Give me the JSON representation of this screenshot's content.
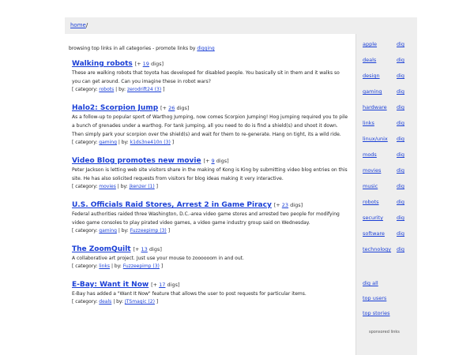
{
  "breadcrumb": {
    "home": "home",
    "separator": "/"
  },
  "intro": {
    "text": "browsing top links in all categories - promote links by",
    "link": "digging"
  },
  "stories": [
    {
      "title": "Walking robots",
      "diggs_open": "[+",
      "diggs_count": "19",
      "diggs_close": "digs]",
      "desc": "These are walking robots that toyota has developed for disabled people. You basically sit in them and it walks so you can get around. Can you imagine these in robot wars?",
      "meta_open": "[ category:",
      "category": "robots",
      "meta_by": "| by:",
      "user": "zerodrift24 (3)",
      "meta_close": "]"
    },
    {
      "title": "Halo2: Scorpion Jump",
      "diggs_open": "[+",
      "diggs_count": "26",
      "diggs_close": "digs]",
      "desc": "As a follow-up to popular sport of Warthog Jumping, now comes Scorpion Jumping! Hog jumping required you to pile a bunch of grenades under a warthog. For tank jumping, all you need to do is find a shield(s) and shoot it down. Then simply park your scorpion over the shield(s) and wait for them to re-generate. Hang on tight, its a wild ride.",
      "meta_open": "[ category:",
      "category": "gaming",
      "meta_by": "| by:",
      "user": "k1ds3ne410n (3)",
      "meta_close": "]"
    },
    {
      "title": "Video Blog promotes new movie",
      "diggs_open": "[+",
      "diggs_count": "9",
      "diggs_close": "digs]",
      "desc": "Peter Jackson is letting web site visitors share in the making of Kong is King by submitting video blog entries on this site. He has also solicited requests from visitors for blog ideas making it very interactive.",
      "meta_open": "[ category:",
      "category": "movies",
      "meta_by": "| by:",
      "user": "jkenzer (1)",
      "meta_close": "]"
    },
    {
      "title": "U.S. Officials Raid Stores, Arrest 2 in Game Piracy",
      "diggs_open": "[+",
      "diggs_count": "23",
      "diggs_close": "digs]",
      "desc": "Federal authorities raided three Washington, D.C.-area video game stores and arrested two people for modifying video game consoles to play pirated video games, a video game industry group said on Wednesday.",
      "meta_open": "[ category:",
      "category": "gaming",
      "meta_by": "| by:",
      "user": "Fuzzeepimp (3)",
      "meta_close": "]"
    },
    {
      "title": "The ZoomQuilt",
      "diggs_open": "[+",
      "diggs_count": "13",
      "diggs_close": "digs]",
      "desc": "A collaborative art project. Just use your mouse to zoooooom in and out.",
      "meta_open": "[ category:",
      "category": "links",
      "meta_by": "| by:",
      "user": "Fuzzeepimp (3)",
      "meta_close": "]"
    },
    {
      "title": "E-Bay: Want it Now",
      "diggs_open": "[+",
      "diggs_count": "17",
      "diggs_close": "digs]",
      "desc": "E-Bay has added a \"Want It Now\" feature that allows the user to post requests for particular items.",
      "meta_open": "[ category:",
      "category": "deals",
      "meta_by": "| by:",
      "user": "JTSmagic (2)",
      "meta_close": "]"
    }
  ],
  "sidebar": {
    "categories": [
      {
        "name": "apple",
        "dig": "dig"
      },
      {
        "name": "deals",
        "dig": "dig"
      },
      {
        "name": "design",
        "dig": "dig"
      },
      {
        "name": "gaming",
        "dig": "dig"
      },
      {
        "name": "hardware",
        "dig": "dig"
      },
      {
        "name": "links",
        "dig": "dig"
      },
      {
        "name": "linux/unix",
        "dig": "dig"
      },
      {
        "name": "mods",
        "dig": "dig"
      },
      {
        "name": "movies",
        "dig": "dig"
      },
      {
        "name": "music",
        "dig": "dig"
      },
      {
        "name": "robots",
        "dig": "dig"
      },
      {
        "name": "security",
        "dig": "dig"
      },
      {
        "name": "software",
        "dig": "dig"
      },
      {
        "name": "technology",
        "dig": "dig"
      }
    ],
    "extras": [
      "dig all",
      "top users",
      "top stories"
    ],
    "sponsored": "sponsored links"
  },
  "colors": {
    "link": "#1a3fd6",
    "chrome_gray": "#eeeeee",
    "background": "#ffffff"
  }
}
